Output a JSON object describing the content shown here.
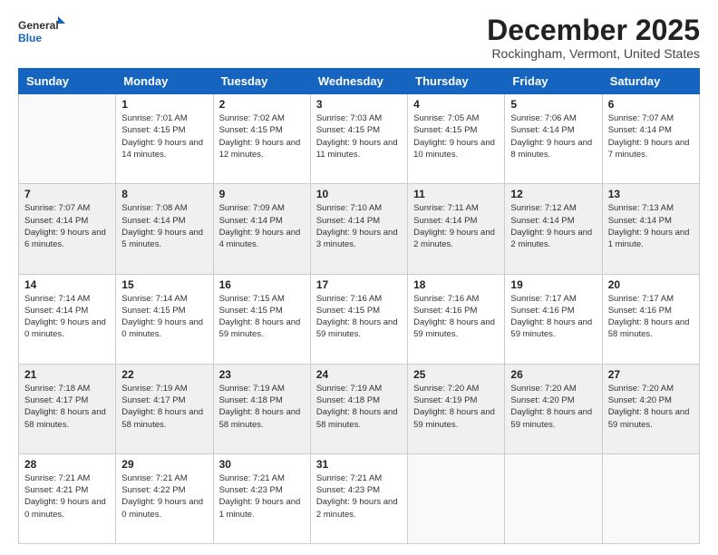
{
  "header": {
    "logo_line1": "General",
    "logo_line2": "Blue",
    "month_title": "December 2025",
    "location": "Rockingham, Vermont, United States"
  },
  "weekdays": [
    "Sunday",
    "Monday",
    "Tuesday",
    "Wednesday",
    "Thursday",
    "Friday",
    "Saturday"
  ],
  "weeks": [
    [
      {
        "day": "",
        "sunrise": "",
        "sunset": "",
        "daylight": ""
      },
      {
        "day": "1",
        "sunrise": "Sunrise: 7:01 AM",
        "sunset": "Sunset: 4:15 PM",
        "daylight": "Daylight: 9 hours and 14 minutes."
      },
      {
        "day": "2",
        "sunrise": "Sunrise: 7:02 AM",
        "sunset": "Sunset: 4:15 PM",
        "daylight": "Daylight: 9 hours and 12 minutes."
      },
      {
        "day": "3",
        "sunrise": "Sunrise: 7:03 AM",
        "sunset": "Sunset: 4:15 PM",
        "daylight": "Daylight: 9 hours and 11 minutes."
      },
      {
        "day": "4",
        "sunrise": "Sunrise: 7:05 AM",
        "sunset": "Sunset: 4:15 PM",
        "daylight": "Daylight: 9 hours and 10 minutes."
      },
      {
        "day": "5",
        "sunrise": "Sunrise: 7:06 AM",
        "sunset": "Sunset: 4:14 PM",
        "daylight": "Daylight: 9 hours and 8 minutes."
      },
      {
        "day": "6",
        "sunrise": "Sunrise: 7:07 AM",
        "sunset": "Sunset: 4:14 PM",
        "daylight": "Daylight: 9 hours and 7 minutes."
      }
    ],
    [
      {
        "day": "7",
        "sunrise": "Sunrise: 7:07 AM",
        "sunset": "Sunset: 4:14 PM",
        "daylight": "Daylight: 9 hours and 6 minutes."
      },
      {
        "day": "8",
        "sunrise": "Sunrise: 7:08 AM",
        "sunset": "Sunset: 4:14 PM",
        "daylight": "Daylight: 9 hours and 5 minutes."
      },
      {
        "day": "9",
        "sunrise": "Sunrise: 7:09 AM",
        "sunset": "Sunset: 4:14 PM",
        "daylight": "Daylight: 9 hours and 4 minutes."
      },
      {
        "day": "10",
        "sunrise": "Sunrise: 7:10 AM",
        "sunset": "Sunset: 4:14 PM",
        "daylight": "Daylight: 9 hours and 3 minutes."
      },
      {
        "day": "11",
        "sunrise": "Sunrise: 7:11 AM",
        "sunset": "Sunset: 4:14 PM",
        "daylight": "Daylight: 9 hours and 2 minutes."
      },
      {
        "day": "12",
        "sunrise": "Sunrise: 7:12 AM",
        "sunset": "Sunset: 4:14 PM",
        "daylight": "Daylight: 9 hours and 2 minutes."
      },
      {
        "day": "13",
        "sunrise": "Sunrise: 7:13 AM",
        "sunset": "Sunset: 4:14 PM",
        "daylight": "Daylight: 9 hours and 1 minute."
      }
    ],
    [
      {
        "day": "14",
        "sunrise": "Sunrise: 7:14 AM",
        "sunset": "Sunset: 4:14 PM",
        "daylight": "Daylight: 9 hours and 0 minutes."
      },
      {
        "day": "15",
        "sunrise": "Sunrise: 7:14 AM",
        "sunset": "Sunset: 4:15 PM",
        "daylight": "Daylight: 9 hours and 0 minutes."
      },
      {
        "day": "16",
        "sunrise": "Sunrise: 7:15 AM",
        "sunset": "Sunset: 4:15 PM",
        "daylight": "Daylight: 8 hours and 59 minutes."
      },
      {
        "day": "17",
        "sunrise": "Sunrise: 7:16 AM",
        "sunset": "Sunset: 4:15 PM",
        "daylight": "Daylight: 8 hours and 59 minutes."
      },
      {
        "day": "18",
        "sunrise": "Sunrise: 7:16 AM",
        "sunset": "Sunset: 4:16 PM",
        "daylight": "Daylight: 8 hours and 59 minutes."
      },
      {
        "day": "19",
        "sunrise": "Sunrise: 7:17 AM",
        "sunset": "Sunset: 4:16 PM",
        "daylight": "Daylight: 8 hours and 59 minutes."
      },
      {
        "day": "20",
        "sunrise": "Sunrise: 7:17 AM",
        "sunset": "Sunset: 4:16 PM",
        "daylight": "Daylight: 8 hours and 58 minutes."
      }
    ],
    [
      {
        "day": "21",
        "sunrise": "Sunrise: 7:18 AM",
        "sunset": "Sunset: 4:17 PM",
        "daylight": "Daylight: 8 hours and 58 minutes."
      },
      {
        "day": "22",
        "sunrise": "Sunrise: 7:19 AM",
        "sunset": "Sunset: 4:17 PM",
        "daylight": "Daylight: 8 hours and 58 minutes."
      },
      {
        "day": "23",
        "sunrise": "Sunrise: 7:19 AM",
        "sunset": "Sunset: 4:18 PM",
        "daylight": "Daylight: 8 hours and 58 minutes."
      },
      {
        "day": "24",
        "sunrise": "Sunrise: 7:19 AM",
        "sunset": "Sunset: 4:18 PM",
        "daylight": "Daylight: 8 hours and 58 minutes."
      },
      {
        "day": "25",
        "sunrise": "Sunrise: 7:20 AM",
        "sunset": "Sunset: 4:19 PM",
        "daylight": "Daylight: 8 hours and 59 minutes."
      },
      {
        "day": "26",
        "sunrise": "Sunrise: 7:20 AM",
        "sunset": "Sunset: 4:20 PM",
        "daylight": "Daylight: 8 hours and 59 minutes."
      },
      {
        "day": "27",
        "sunrise": "Sunrise: 7:20 AM",
        "sunset": "Sunset: 4:20 PM",
        "daylight": "Daylight: 8 hours and 59 minutes."
      }
    ],
    [
      {
        "day": "28",
        "sunrise": "Sunrise: 7:21 AM",
        "sunset": "Sunset: 4:21 PM",
        "daylight": "Daylight: 9 hours and 0 minutes."
      },
      {
        "day": "29",
        "sunrise": "Sunrise: 7:21 AM",
        "sunset": "Sunset: 4:22 PM",
        "daylight": "Daylight: 9 hours and 0 minutes."
      },
      {
        "day": "30",
        "sunrise": "Sunrise: 7:21 AM",
        "sunset": "Sunset: 4:23 PM",
        "daylight": "Daylight: 9 hours and 1 minute."
      },
      {
        "day": "31",
        "sunrise": "Sunrise: 7:21 AM",
        "sunset": "Sunset: 4:23 PM",
        "daylight": "Daylight: 9 hours and 2 minutes."
      },
      {
        "day": "",
        "sunrise": "",
        "sunset": "",
        "daylight": ""
      },
      {
        "day": "",
        "sunrise": "",
        "sunset": "",
        "daylight": ""
      },
      {
        "day": "",
        "sunrise": "",
        "sunset": "",
        "daylight": ""
      }
    ]
  ]
}
